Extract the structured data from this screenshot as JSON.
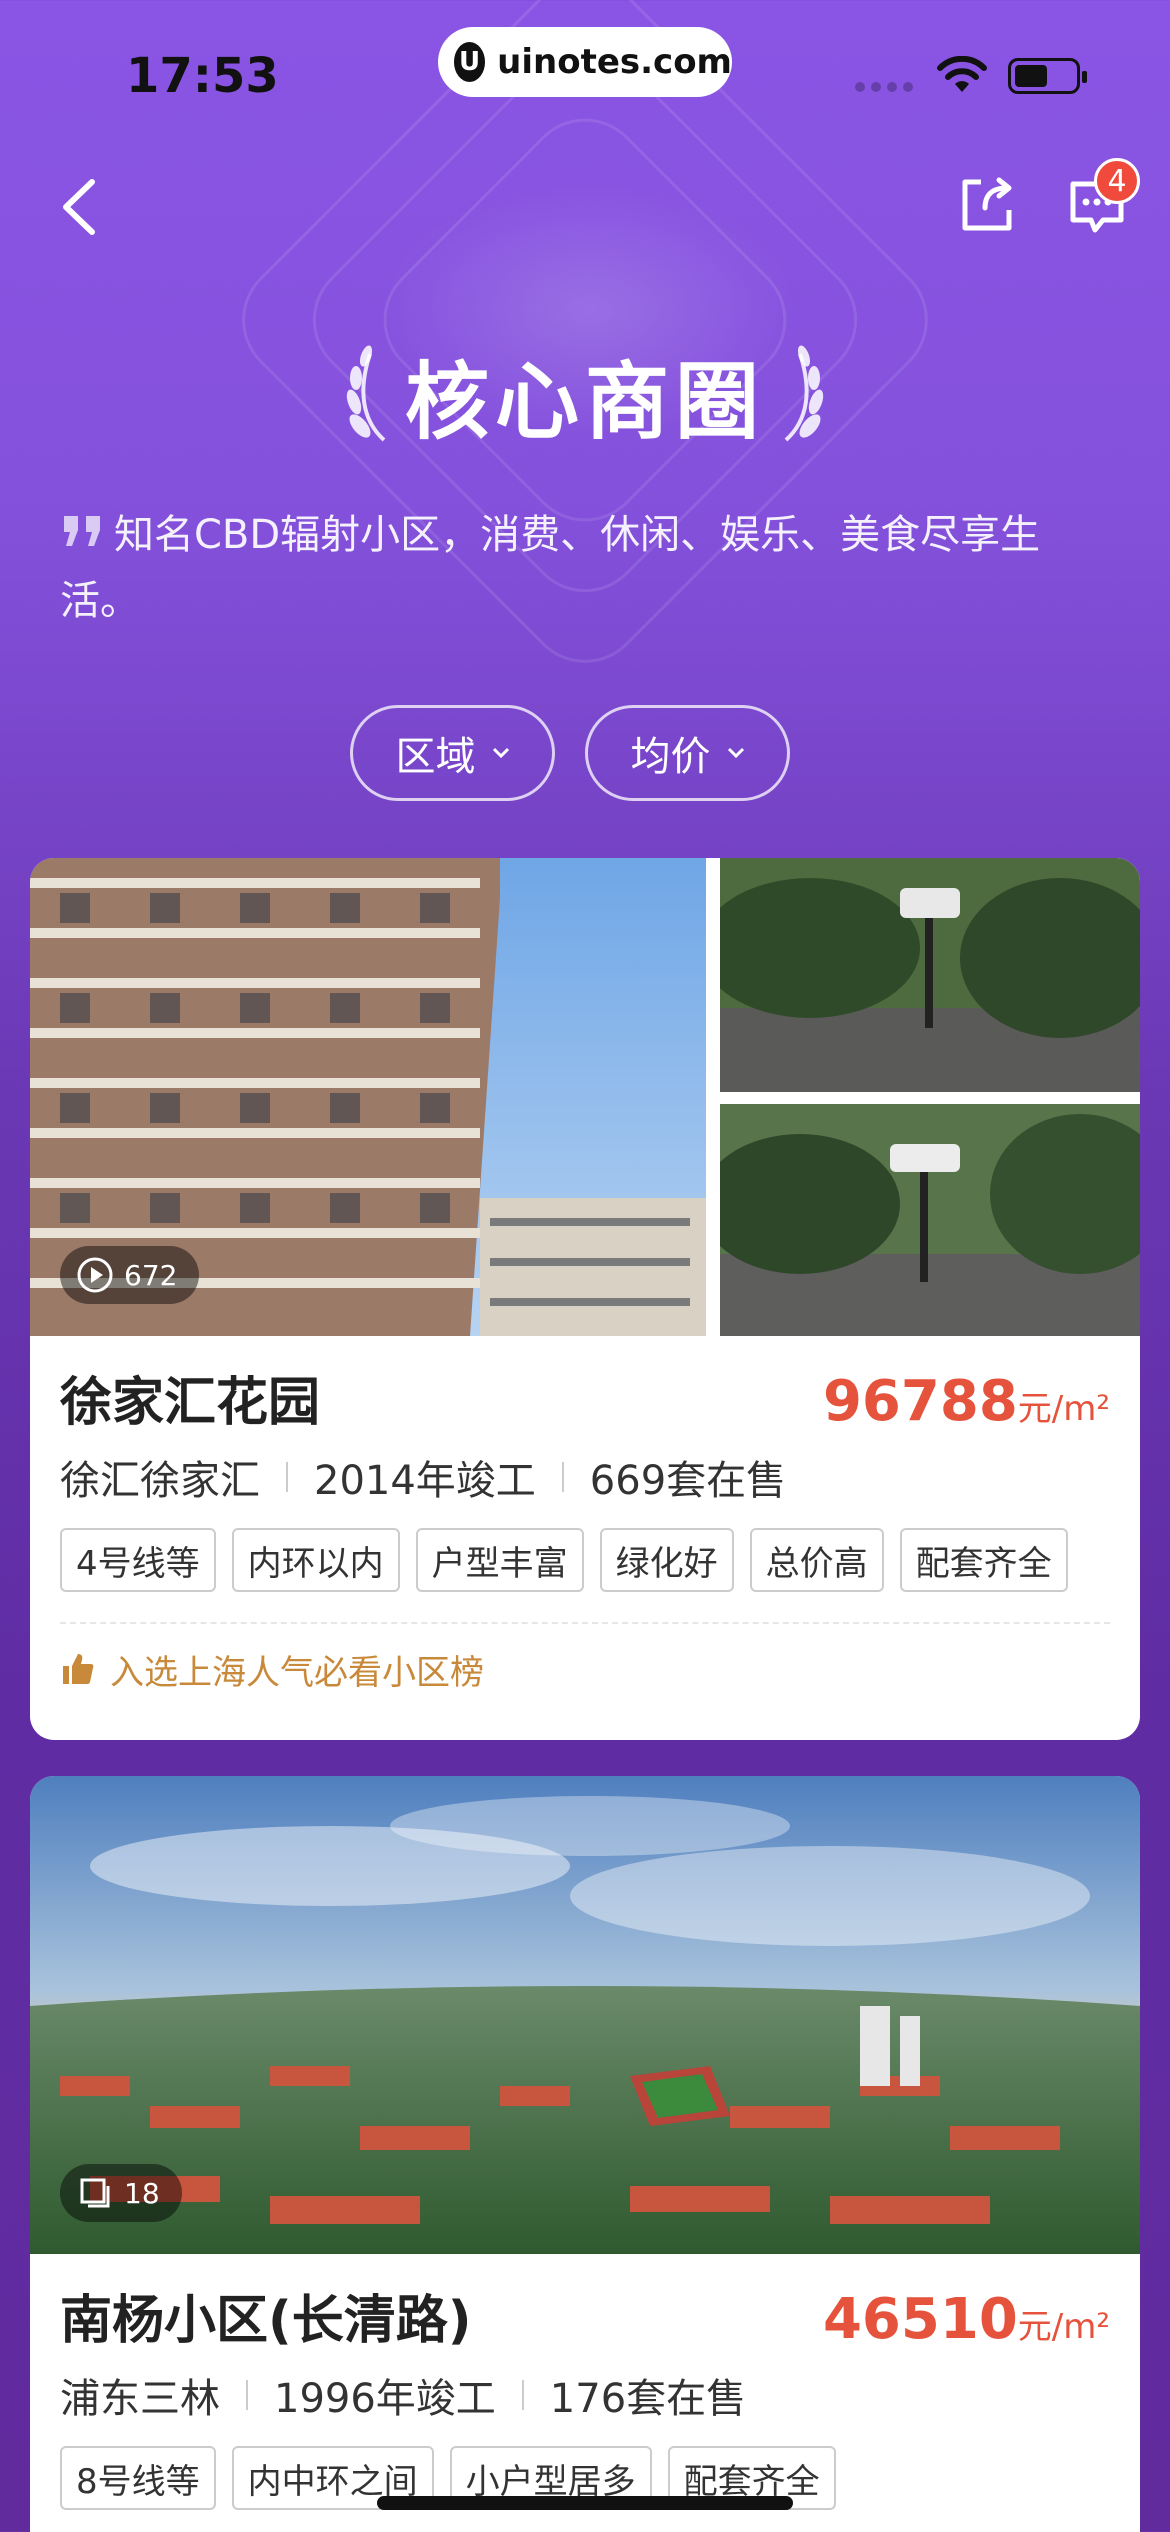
{
  "status_bar": {
    "time": "17:53",
    "url": "uinotes.com"
  },
  "nav": {
    "message_count": "4"
  },
  "header": {
    "title": "核心商圈",
    "subtitle": "知名CBD辐射小区，消费、休闲、娱乐、美食尽享生活。"
  },
  "filters": [
    {
      "label": "区域"
    },
    {
      "label": "均价"
    }
  ],
  "listings": [
    {
      "name": "徐家汇花园",
      "price": "96788",
      "price_unit": "元/m²",
      "district": "徐汇徐家汇",
      "built": "2014年竣工",
      "on_sale": "669套在售",
      "media_count": "672",
      "tags": [
        "4号线等",
        "内环以内",
        "户型丰富",
        "绿化好",
        "总价高",
        "配套齐全"
      ],
      "honor": "入选上海人气必看小区榜"
    },
    {
      "name": "南杨小区(长清路)",
      "price": "46510",
      "price_unit": "元/m²",
      "district": "浦东三林",
      "built": "1996年竣工",
      "on_sale": "176套在售",
      "media_count": "18",
      "tags": [
        "8号线等",
        "内中环之间",
        "小户型居多",
        "配套齐全"
      ]
    }
  ],
  "colors": {
    "accent": "#e5533d",
    "honor": "#c8893a",
    "bg_top": "#8a55e4",
    "bg_bottom": "#612b9e"
  }
}
